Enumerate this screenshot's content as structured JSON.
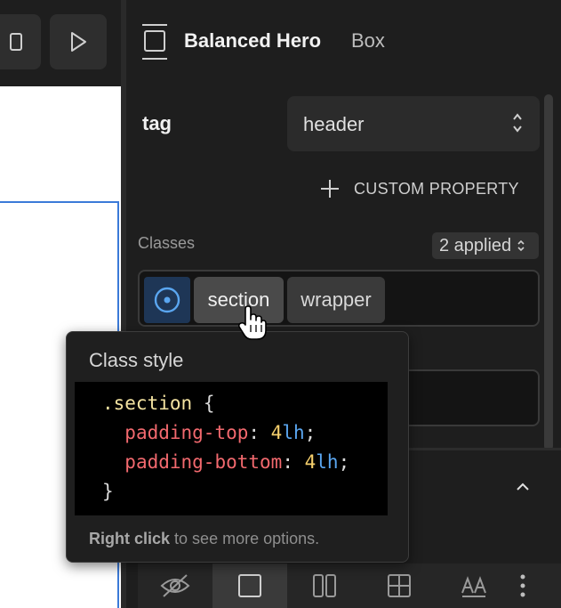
{
  "panel": {
    "title": "Balanced Hero",
    "subtitle": "Box",
    "tag": {
      "label": "tag",
      "value": "header"
    },
    "custom_property": "CUSTOM PROPERTY",
    "classes": {
      "label": "Classes",
      "applied": "2 applied",
      "chips": [
        "section",
        "wrapper"
      ]
    }
  },
  "tooltip": {
    "title": "Class style",
    "code": {
      "selector": ".section",
      "open": "{",
      "close": "}",
      "rules": [
        {
          "prop": "padding-top",
          "num": "4",
          "unit": "lh"
        },
        {
          "prop": "padding-bottom",
          "num": "4",
          "unit": "lh"
        }
      ]
    },
    "hint_bold": "Right click",
    "hint": "to see more options."
  },
  "colors": {
    "accent": "#3b7ad8",
    "panel_bg": "#1e1e1e",
    "selector": "#f4e3a1",
    "property": "#f2696e",
    "unit": "#5aa6f0"
  },
  "icons": [
    "mobile-icon",
    "play-icon",
    "box-icon",
    "select-arrows-icon",
    "plus-icon",
    "target-icon",
    "chevron-up-icon",
    "eye-off-icon",
    "square-icon",
    "columns-icon",
    "grid-icon",
    "text-size-icon",
    "more-icon",
    "hand-cursor-icon"
  ]
}
